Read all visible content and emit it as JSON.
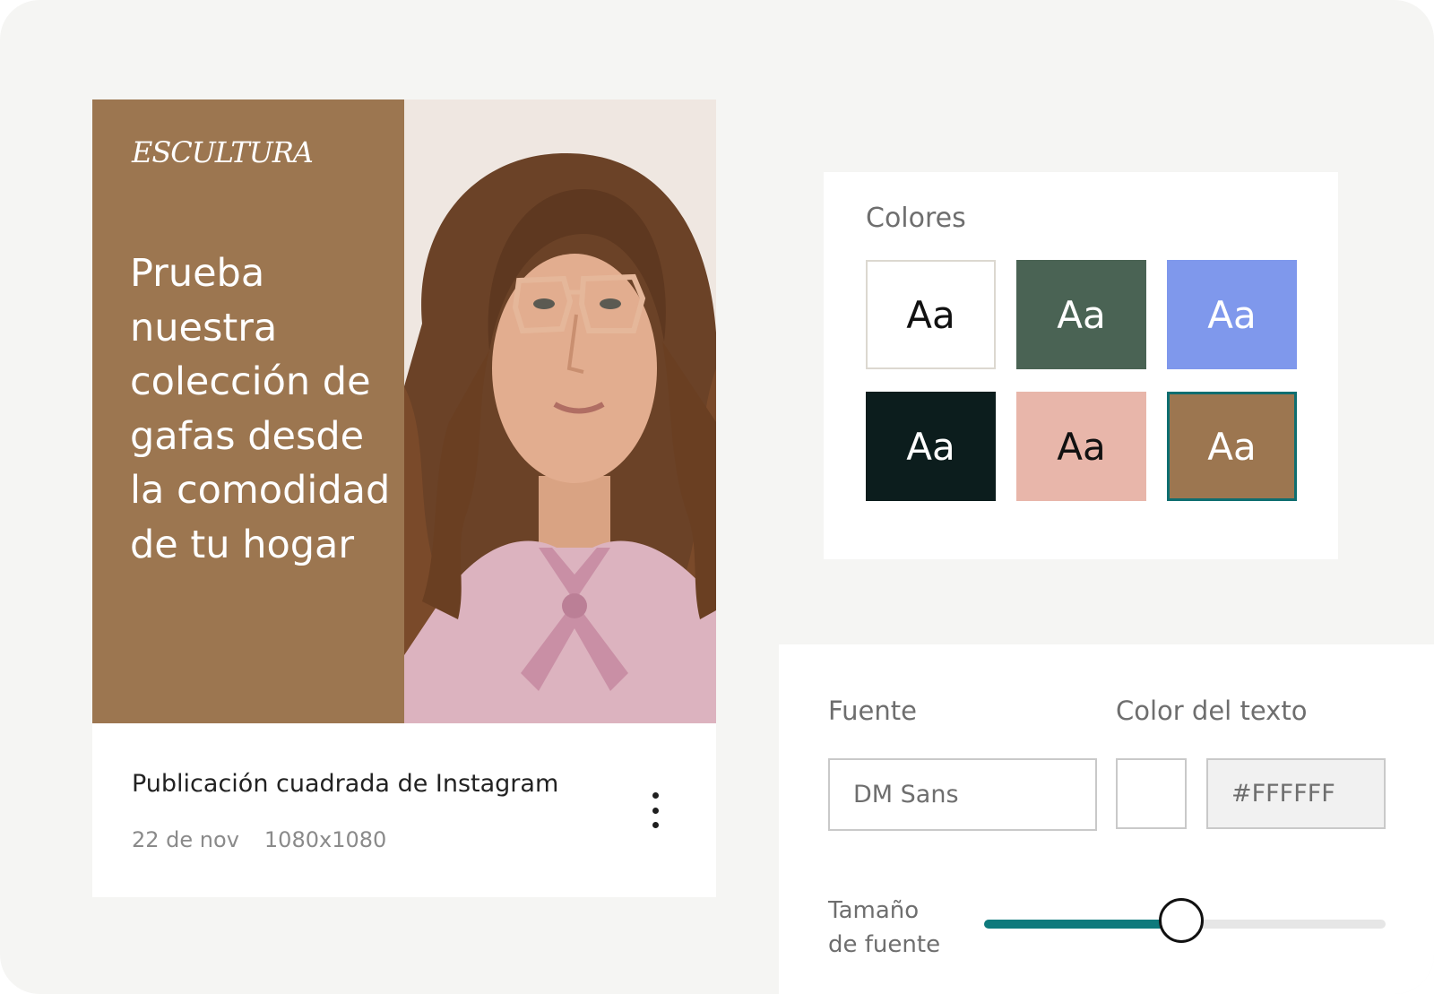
{
  "post": {
    "brand": "ESCULTURA",
    "headline": "Prueba nuestra colección de gafas desde la comodidad de tu hogar",
    "title": "Publicación cuadrada de Instagram",
    "date": "22 de nov",
    "size": "1080x1080",
    "menu_icon": "vertical-ellipsis-icon",
    "brand_color": "#9c7650"
  },
  "colors": {
    "label": "Colores",
    "swatches": [
      {
        "text": "Aa",
        "bg": "#ffffff",
        "fg": "#111111",
        "border": "#dcd8d0",
        "selected": false
      },
      {
        "text": "Aa",
        "bg": "#4a6354",
        "fg": "#ffffff",
        "border": "",
        "selected": false
      },
      {
        "text": "Aa",
        "bg": "#7f98ec",
        "fg": "#ffffff",
        "border": "",
        "selected": false
      },
      {
        "text": "Aa",
        "bg": "#0c1d1d",
        "fg": "#ffffff",
        "border": "",
        "selected": false
      },
      {
        "text": "Aa",
        "bg": "#e8b6aa",
        "fg": "#111111",
        "border": "",
        "selected": false
      },
      {
        "text": "Aa",
        "bg": "#9c7650",
        "fg": "#ffffff",
        "border": "#0e6e70",
        "selected": true
      }
    ]
  },
  "font": {
    "font_label": "Fuente",
    "font_value": "DM Sans",
    "text_color_label": "Color del texto",
    "text_color_value": "#FFFFFF",
    "size_label_line1": "Tamaño",
    "size_label_line2": "de fuente",
    "size_level": 0.49,
    "accent": "#0e7a7c"
  }
}
